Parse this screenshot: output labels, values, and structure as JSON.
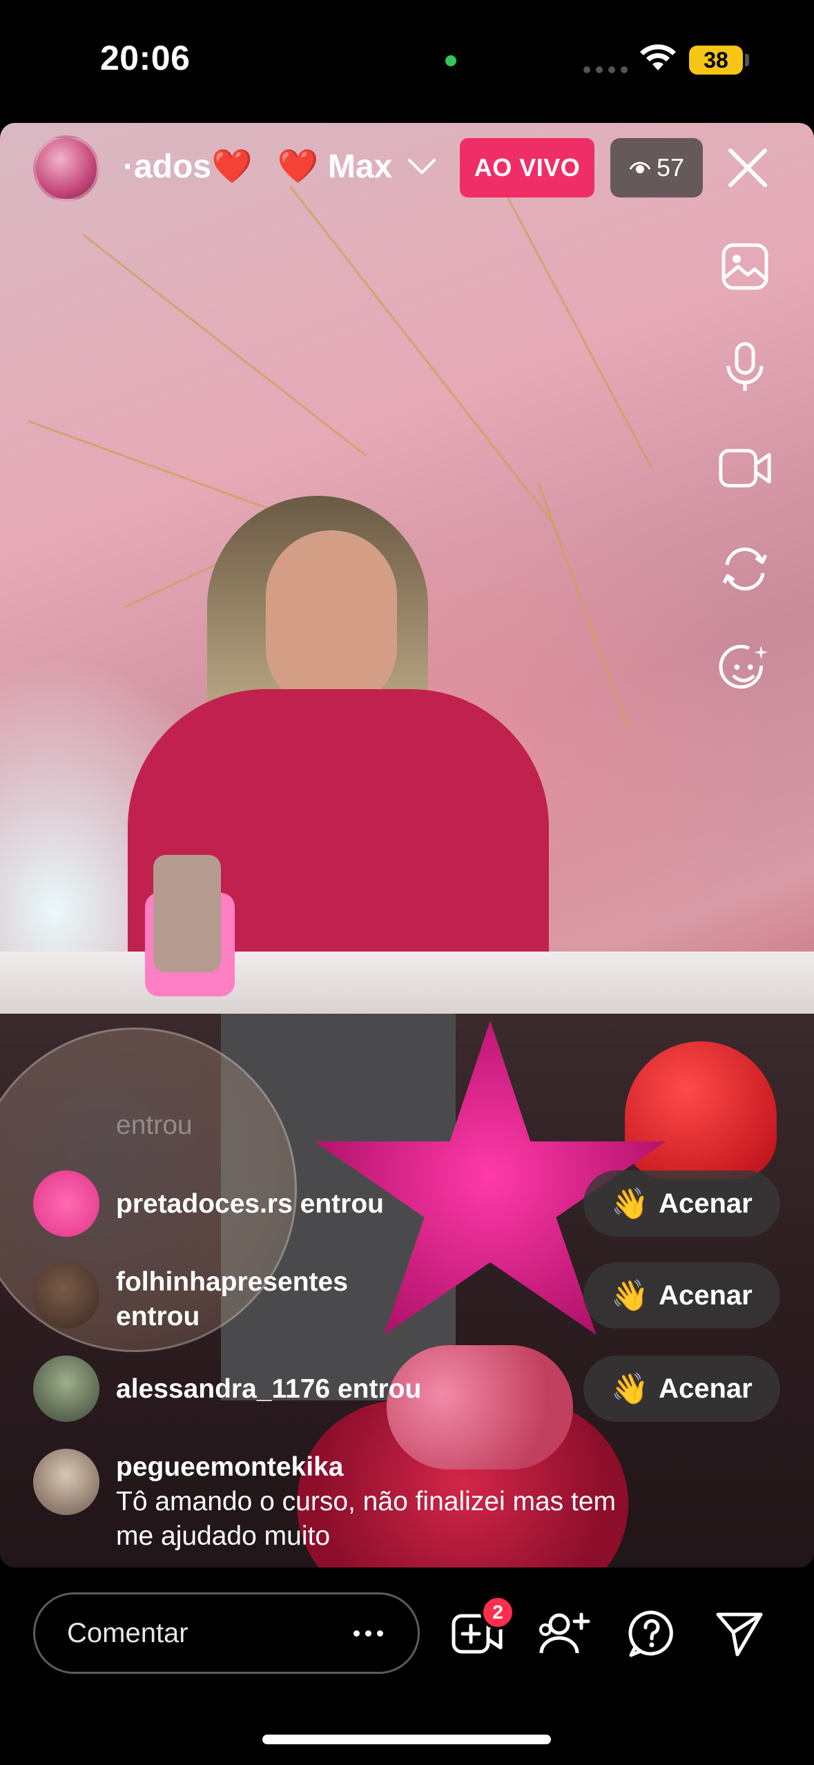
{
  "status_bar": {
    "time": "20:06",
    "battery": "38",
    "icons": [
      "green-dot-indicator",
      "cellular-icon",
      "wifi-icon",
      "battery-icon"
    ]
  },
  "live": {
    "title_left": "·ados❤️",
    "title_right": "❤️ Max",
    "badge": "AO VIVO",
    "viewers": "57"
  },
  "side_tools": [
    "image-icon",
    "microphone-icon",
    "video-camera-icon",
    "switch-camera-icon",
    "face-effects-icon"
  ],
  "comments": [
    {
      "user": "",
      "action": "entrou",
      "faded": true
    },
    {
      "user": "pretadoces.rs",
      "action": "entrou",
      "wave": "Acenar"
    },
    {
      "user": "folhinhapresentes",
      "action": "entrou",
      "wave": "Acenar"
    },
    {
      "user": "alessandra_1176",
      "action": "entrou",
      "wave": "Acenar"
    },
    {
      "user": "pegueemontekika",
      "message_line1": "Tô amando o curso, não finalizei mas tem",
      "message_line2": "me ajudado muito"
    }
  ],
  "wave_emoji": "👋",
  "bottom": {
    "comment_placeholder": "Comentar",
    "invite_badge": "2"
  }
}
